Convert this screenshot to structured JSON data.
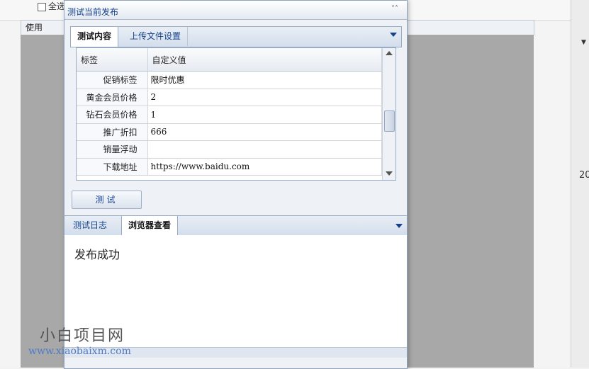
{
  "background": {
    "select_all_label": "全选",
    "column_header": "使用",
    "right_edge_text": "20"
  },
  "dialog": {
    "title": "测试当前发布",
    "tabs": [
      {
        "label": "测试内容",
        "active": true
      },
      {
        "label": "上传文件设置",
        "active": false
      }
    ],
    "grid": {
      "headers": [
        "标签",
        "自定义值"
      ],
      "rows": [
        {
          "label": "促销标签",
          "value": "限时优惠"
        },
        {
          "label": "黄金会员价格",
          "value": "2"
        },
        {
          "label": "钻石会员价格",
          "value": "1"
        },
        {
          "label": "推广折扣",
          "value": "666"
        },
        {
          "label": "销量浮动",
          "value": ""
        },
        {
          "label": "下载地址",
          "value": "https://www.baidu.com"
        }
      ]
    },
    "test_button": "测试",
    "bottom_tabs": [
      {
        "label": "测试日志",
        "active": false
      },
      {
        "label": "浏览器查看",
        "active": true
      }
    ],
    "log_text": "发布成功"
  },
  "watermark": {
    "name": "小白项目网",
    "url": "www.xiaobaixm.com"
  }
}
